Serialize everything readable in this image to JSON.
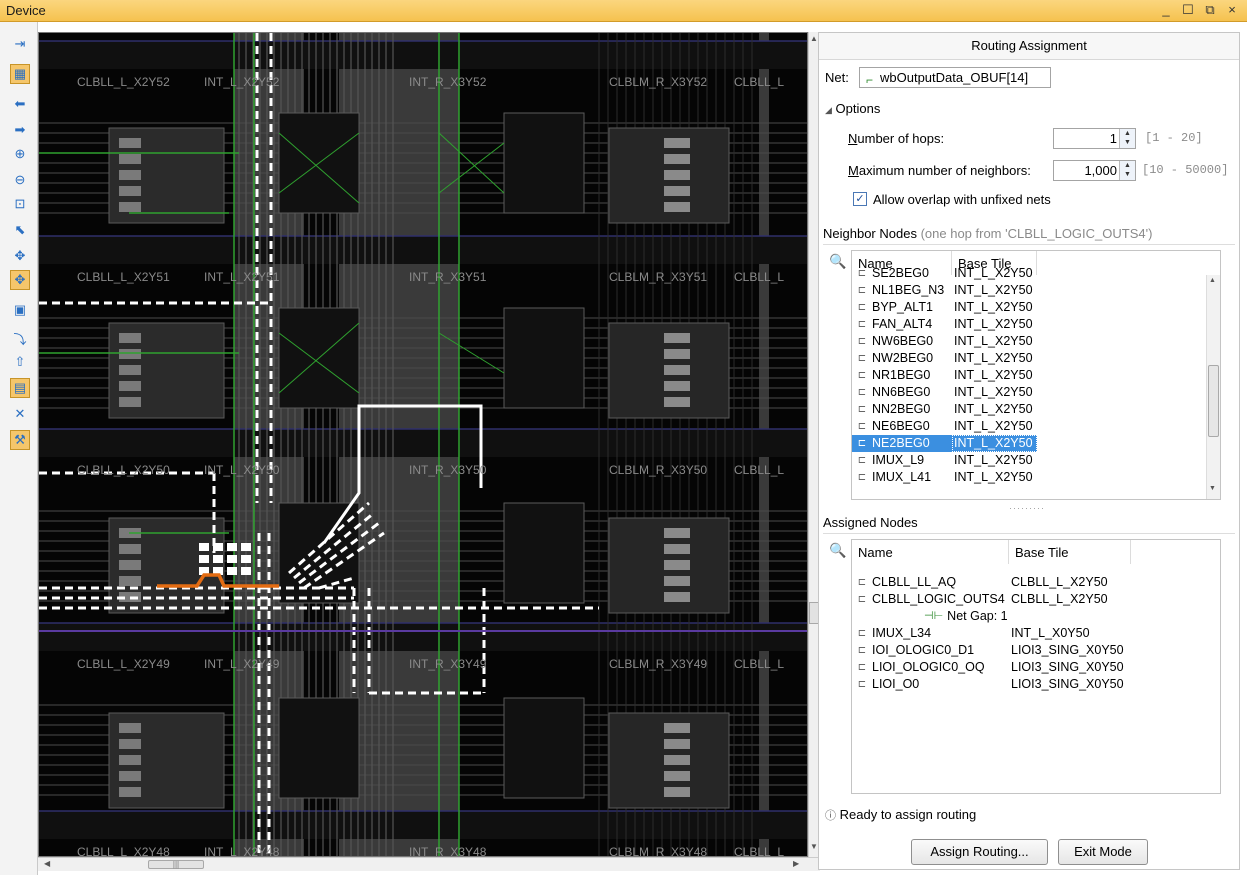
{
  "window": {
    "title": "Device"
  },
  "toolbar": {
    "items": [
      {
        "name": "auto-fit",
        "glyph": "⇥"
      },
      {
        "name": "device-view",
        "glyph": "▦"
      },
      {
        "name": "back",
        "glyph": "⬅"
      },
      {
        "name": "forward",
        "glyph": "➡"
      },
      {
        "name": "zoom-in",
        "glyph": "⊕"
      },
      {
        "name": "zoom-out",
        "glyph": "⊖"
      },
      {
        "name": "zoom-fit",
        "glyph": "⊡"
      },
      {
        "name": "select",
        "glyph": "⬉"
      },
      {
        "name": "move",
        "glyph": "✥"
      },
      {
        "name": "routing",
        "glyph": "✥"
      },
      {
        "name": "place",
        "glyph": "▣"
      },
      {
        "name": "route-net",
        "glyph": "⤵"
      },
      {
        "name": "assign",
        "glyph": "⇧"
      },
      {
        "name": "route-mode",
        "glyph": "▤"
      },
      {
        "name": "unroute",
        "glyph": "✕"
      },
      {
        "name": "tools",
        "glyph": "⚒"
      }
    ]
  },
  "device": {
    "tile_labels": [
      {
        "row": "Y52",
        "items": [
          "CLBLL_L_X2Y52",
          "INT_L_X2Y52",
          "INT_R_X3Y52",
          "CLBLM_R_X3Y52",
          "CLBLL_L"
        ]
      },
      {
        "row": "Y51",
        "items": [
          "CLBLL_L_X2Y51",
          "INT_L_X2Y51",
          "INT_R_X3Y51",
          "CLBLM_R_X3Y51",
          "CLBLL_L"
        ]
      },
      {
        "row": "Y50",
        "items": [
          "CLBLL_L_X2Y50",
          "INT_L_X2Y50",
          "INT_R_X3Y50",
          "CLBLM_R_X3Y50",
          "CLBLL_L"
        ]
      },
      {
        "row": "Y49",
        "items": [
          "CLBLL_L_X2Y49",
          "INT_L_X2Y49",
          "INT_R_X3Y49",
          "CLBLM_R_X3Y49",
          "CLBLL_L"
        ]
      },
      {
        "row": "Y48",
        "items": [
          "CLBLL_L_X2Y48",
          "INT_L_X2Y48",
          "INT_R_X3Y48",
          "CLBLM_R_X3Y48",
          "CLBLL_L"
        ]
      }
    ]
  },
  "panel": {
    "title": "Routing Assignment",
    "net_label": "Net:",
    "net_value": "wbOutputData_OBUF[14]",
    "options_header": "Options",
    "hops_label": "Number of hops:",
    "hops_value": "1",
    "hops_range": "[1 - 20]",
    "neighbors_label": "Maximum number of neighbors:",
    "neighbors_value": "1,000",
    "neighbors_range": "[10 - 50000]",
    "overlap_label": "Allow overlap with unfixed nets",
    "overlap_checked": true,
    "neighbor_header": "Neighbor Nodes",
    "neighbor_sub": "(one hop from 'CLBLL_LOGIC_OUTS4')",
    "neighbor_columns": [
      "Name",
      "Base Tile"
    ],
    "neighbor_rows": [
      {
        "name": "SE2BEG0",
        "tile": "INT_L_X2Y50"
      },
      {
        "name": "NL1BEG_N3",
        "tile": "INT_L_X2Y50"
      },
      {
        "name": "BYP_ALT1",
        "tile": "INT_L_X2Y50"
      },
      {
        "name": "FAN_ALT4",
        "tile": "INT_L_X2Y50"
      },
      {
        "name": "NW6BEG0",
        "tile": "INT_L_X2Y50"
      },
      {
        "name": "NW2BEG0",
        "tile": "INT_L_X2Y50"
      },
      {
        "name": "NR1BEG0",
        "tile": "INT_L_X2Y50"
      },
      {
        "name": "NN6BEG0",
        "tile": "INT_L_X2Y50"
      },
      {
        "name": "NN2BEG0",
        "tile": "INT_L_X2Y50"
      },
      {
        "name": "NE6BEG0",
        "tile": "INT_L_X2Y50"
      },
      {
        "name": "NE2BEG0",
        "tile": "INT_L_X2Y50",
        "selected": true
      },
      {
        "name": "IMUX_L9",
        "tile": "INT_L_X2Y50"
      },
      {
        "name": "IMUX_L41",
        "tile": "INT_L_X2Y50"
      }
    ],
    "assigned_header": "Assigned Nodes",
    "assigned_columns": [
      "Name",
      "Base Tile"
    ],
    "assigned_rows": [
      {
        "name": "CLBLL_LL_AQ",
        "tile": "CLBLL_L_X2Y50"
      },
      {
        "name": "CLBLL_LOGIC_OUTS4",
        "tile": "CLBLL_L_X2Y50"
      },
      {
        "gap": "Net Gap: 1"
      },
      {
        "name": "IMUX_L34",
        "tile": "INT_L_X0Y50"
      },
      {
        "name": "IOI_OLOGIC0_D1",
        "tile": "LIOI3_SING_X0Y50"
      },
      {
        "name": "LIOI_OLOGIC0_OQ",
        "tile": "LIOI3_SING_X0Y50"
      },
      {
        "name": "LIOI_O0",
        "tile": "LIOI3_SING_X0Y50"
      }
    ],
    "status": "Ready to assign routing",
    "assign_button": "Assign Routing...",
    "exit_button": "Exit Mode"
  },
  "colors": {
    "title_bar": "#f5c24f",
    "selection": "#3b8fe0",
    "route_white": "#ffffff",
    "route_green": "#2fa12f",
    "route_orange": "#e46c12"
  }
}
